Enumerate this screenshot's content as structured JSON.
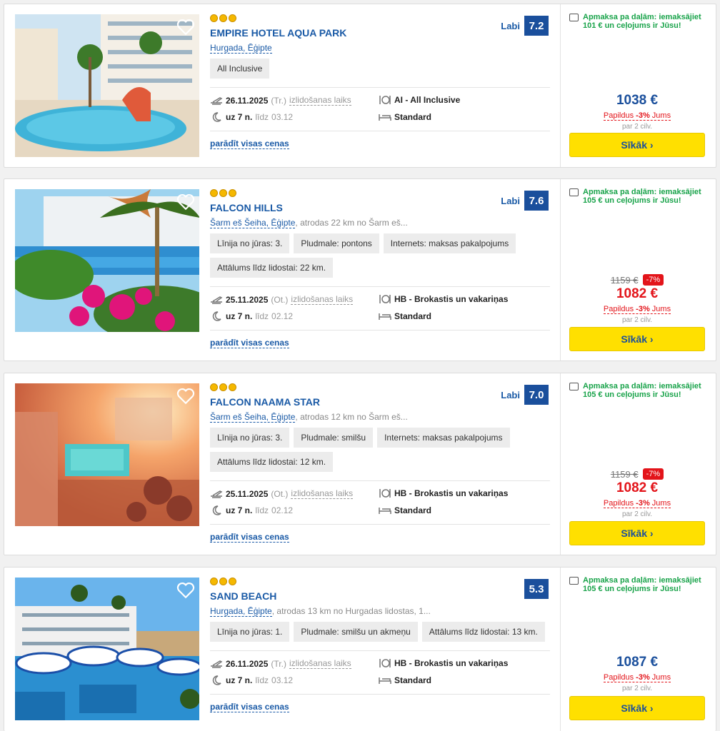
{
  "common": {
    "show_all_label": "parādīt visas cenas",
    "departure_label": "izlidošanas laiks",
    "till_label": "līdz",
    "per_people": "par 2 cilv.",
    "extra_prefix": "Papildus",
    "extra_value": "-3%",
    "extra_suffix": "Jums",
    "more_button": "Sīkāk ›",
    "stars": 3,
    "colors": {
      "brand_blue": "#1a4f9c",
      "link_blue": "#1a5aa6",
      "sale_red": "#e3141a",
      "button_yellow": "#ffe000",
      "installment_green": "#19a34a"
    },
    "icons": [
      "heart-icon",
      "plane-icon",
      "moon-icon",
      "meal-icon",
      "bed-icon",
      "wallet-icon",
      "star-icon"
    ]
  },
  "hotels": [
    {
      "name": "EMPIRE HOTEL AQUA PARK",
      "location": "Hurgada, Ēģipte",
      "location_extra": "",
      "tags": [
        "All Inclusive"
      ],
      "rating_label": "Labi",
      "rating": "7.2",
      "date": "26.11.2025",
      "weekday": "(Tr.)",
      "nights": "uz 7 n.",
      "till": "03.12",
      "meal": "AI - All Inclusive",
      "room": "Standard",
      "installment": "Apmaksa pa daļām: iemaksājiet 101 € un ceļojums ir Jūsu!",
      "old_price": "",
      "discount": "",
      "price": "1038 €"
    },
    {
      "name": "FALCON HILLS",
      "location": "Šarm eš Šeiha, Ēģipte",
      "location_extra": ", atrodas 22 km no Šarm eš...",
      "tags": [
        "Līnija no jūras: 3.",
        "Pludmale: pontons",
        "Internets: maksas pakalpojums",
        "Attālums līdz lidostai: 22 km."
      ],
      "rating_label": "Labi",
      "rating": "7.6",
      "date": "25.11.2025",
      "weekday": "(Ot.)",
      "nights": "uz 7 n.",
      "till": "02.12",
      "meal": "HB - Brokastis un vakariņas",
      "room": "Standard",
      "installment": "Apmaksa pa daļām: iemaksājiet 105 € un ceļojums ir Jūsu!",
      "old_price": "1159 €",
      "discount": "-7%",
      "price": "1082 €"
    },
    {
      "name": "FALCON NAAMA STAR",
      "location": "Šarm eš Šeiha, Ēģipte",
      "location_extra": ", atrodas 12 km no Šarm eš...",
      "tags": [
        "Līnija no jūras: 3.",
        "Pludmale: smilšu",
        "Internets: maksas pakalpojums",
        "Attālums līdz lidostai: 12 km."
      ],
      "rating_label": "Labi",
      "rating": "7.0",
      "date": "25.11.2025",
      "weekday": "(Ot.)",
      "nights": "uz 7 n.",
      "till": "02.12",
      "meal": "HB - Brokastis un vakariņas",
      "room": "Standard",
      "installment": "Apmaksa pa daļām: iemaksājiet 105 € un ceļojums ir Jūsu!",
      "old_price": "1159 €",
      "discount": "-7%",
      "price": "1082 €"
    },
    {
      "name": "SAND BEACH",
      "location": "Hurgada, Ēģipte",
      "location_extra": ", atrodas 13 km no Hurgadas lidostas, 1...",
      "tags": [
        "Līnija no jūras: 1.",
        "Pludmale: smilšu un akmeņu",
        "Attālums līdz lidostai: 13 km."
      ],
      "rating_label": "",
      "rating": "5.3",
      "date": "26.11.2025",
      "weekday": "(Tr.)",
      "nights": "uz 7 n.",
      "till": "03.12",
      "meal": "HB - Brokastis un vakariņas",
      "room": "Standard",
      "installment": "Apmaksa pa daļām: iemaksājiet 105 € un ceļojums ir Jūsu!",
      "old_price": "",
      "discount": "",
      "price": "1087 €"
    }
  ]
}
